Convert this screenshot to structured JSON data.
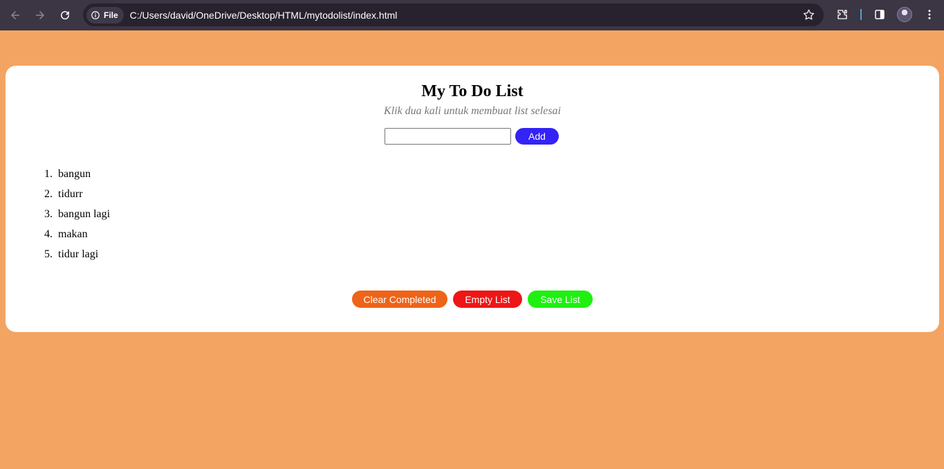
{
  "browser": {
    "url": "C:/Users/david/OneDrive/Desktop/HTML/mytodolist/index.html",
    "file_chip_label": "File",
    "icons": [
      "back-arrow-icon",
      "forward-arrow-icon",
      "reload-icon",
      "info-icon",
      "star-icon",
      "extensions-icon",
      "side-panel-icon",
      "avatar",
      "kebab-menu-icon"
    ]
  },
  "app": {
    "title": "My To Do List",
    "subtitle": "Klik dua kali untuk membuat list selesai",
    "input_value": "",
    "add_label": "Add",
    "items": [
      {
        "num": "1.",
        "text": "bangun"
      },
      {
        "num": "2.",
        "text": "tidurr"
      },
      {
        "num": "3.",
        "text": "bangun lagi"
      },
      {
        "num": "4.",
        "text": "makan"
      },
      {
        "num": "5.",
        "text": "tidur lagi"
      }
    ],
    "actions": {
      "clear_completed": "Clear Completed",
      "empty_list": "Empty List",
      "save_list": "Save List"
    }
  },
  "colors": {
    "page_bg": "#f4a462",
    "add_button": "#3423f5",
    "clear_button": "#ee6418",
    "empty_button": "#ee1616",
    "save_button": "#1ff012"
  }
}
